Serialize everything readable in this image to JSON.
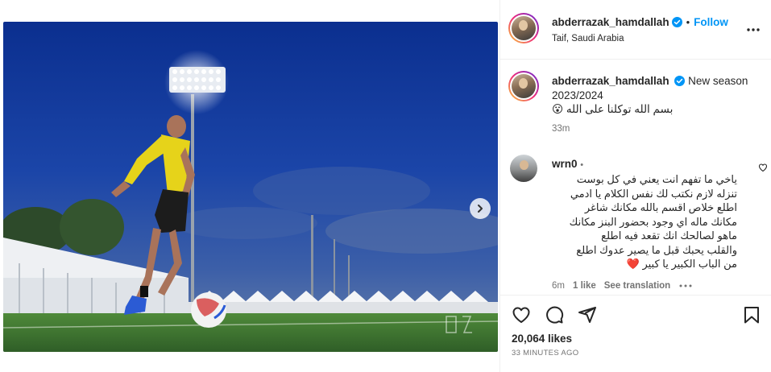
{
  "post": {
    "username": "abderrazak_hamdallah",
    "follow_label": "Follow",
    "separator": "•",
    "location": "Taif, Saudi Arabia"
  },
  "caption": {
    "username": "abderrazak_hamdallah",
    "text_line1": "New season",
    "text_line2": "2023/2024",
    "arabic": "بسم الله توكلنا على الله 😮",
    "time": "33m"
  },
  "comment": {
    "username": "wrn0",
    "separator": "•",
    "lines": [
      "ياخي ما تفهم انت يعني في كل بوست",
      "تنزله لازم نكتب لك نفس الكلام يا ادمي",
      "اطلع خلاص اقسم بالله مكانك شاغر",
      "مكانك ماله اي وجود بحضور البنز مكانك",
      "ماهو لصالحك انك تقعد فيه اطلع",
      "والقلب يحبك قبل ما يصير عدوك اطلع",
      "من الباب الكبير يا كبير ❤️"
    ],
    "time": "6m",
    "likes": "1 like",
    "translation": "See translation"
  },
  "stats": {
    "likes": "20,064 likes",
    "time_ago": "33 MINUTES AGO"
  },
  "carousel": {
    "total": 2,
    "current": 1
  },
  "colors": {
    "accent": "#0095f6",
    "verified": "#0095f6",
    "heart_red": "#ed4956",
    "meta_gray": "#737373"
  },
  "icons": [
    "verified-icon",
    "more-icon",
    "chevron-right-icon",
    "heart-icon",
    "comment-icon",
    "share-icon",
    "bookmark-icon"
  ]
}
